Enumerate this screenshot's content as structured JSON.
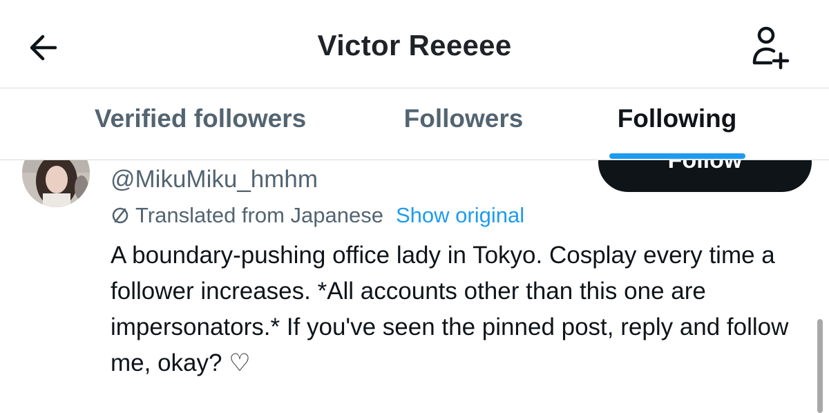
{
  "header": {
    "title": "Victor Reeeee",
    "back_icon": "arrow-left-icon",
    "follow_icon": "person-add-icon"
  },
  "tabs": [
    {
      "label": "Verified followers",
      "active": false
    },
    {
      "label": "Followers",
      "active": false
    },
    {
      "label": "Following",
      "active": true
    }
  ],
  "user": {
    "handle": "@MikuMiku_hmhm",
    "follow_label": "Follow",
    "translation_note": "Translated from Japanese",
    "show_original_label": "Show original",
    "bio": "A boundary-pushing office lady in Tokyo. Cosplay every time a follower increases. *All accounts other than this one are impersonators.* If you've seen the pinned post, reply and follow me, okay? ♡"
  },
  "colors": {
    "accent": "#1d9bf0",
    "text_primary": "#0f1419",
    "text_secondary": "#536471",
    "follow_button_bg": "#0f1419"
  }
}
